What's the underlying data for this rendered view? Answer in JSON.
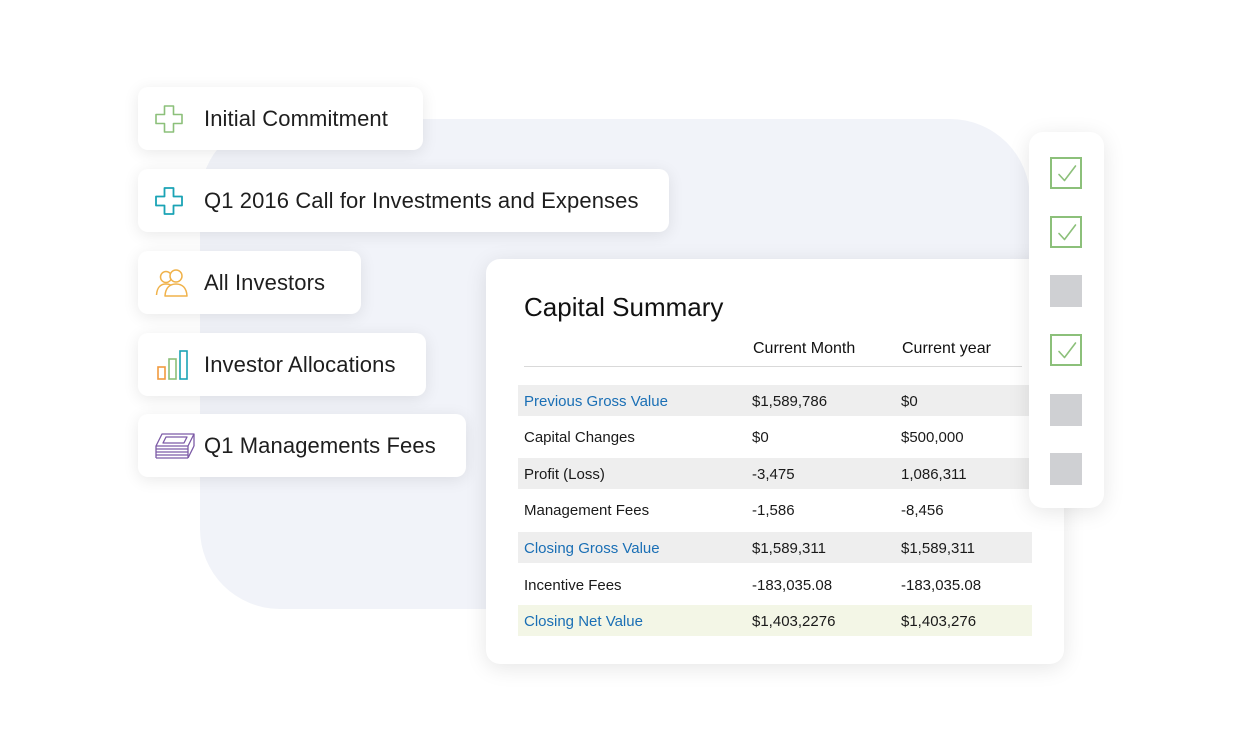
{
  "steps": [
    {
      "label": "Initial Commitment",
      "icon": "plus-outline-icon",
      "color": "#8cc07a"
    },
    {
      "label": "Q1 2016 Call for Investments and Expenses",
      "icon": "plus-outline-icon",
      "color": "#1aa3b5"
    },
    {
      "label": "All Investors",
      "icon": "investors-group-icon",
      "color": "#f0b24a"
    },
    {
      "label": "Investor Allocations",
      "icon": "bar-chart-icon",
      "colors": [
        "#f29a3e",
        "#8cc07a",
        "#1aa3b5"
      ]
    },
    {
      "label": "Q1 Managements Fees",
      "icon": "cash-stack-icon",
      "color": "#7c5aa6"
    }
  ],
  "summary": {
    "title": "Capital Summary",
    "columns": {
      "current_month": "Current Month",
      "current_year": "Current year"
    },
    "rows": [
      {
        "label": "Previous Gross Value",
        "current_month": "$1,589,786",
        "current_year": "$0",
        "style": "link",
        "shade": true
      },
      {
        "label": "Capital Changes",
        "current_month": "$0",
        "current_year": "$500,000",
        "style": "plain",
        "shade": false
      },
      {
        "label": "Profit (Loss)",
        "current_month": "-3,475",
        "current_year": "1,086,311",
        "style": "plain",
        "shade": true
      },
      {
        "label": "Management Fees",
        "current_month": "-1,586",
        "current_year": "-8,456",
        "style": "plain",
        "shade": false
      },
      {
        "label": "Closing Gross Value",
        "current_month": "$1,589,311",
        "current_year": "$1,589,311",
        "style": "link",
        "shade": true
      },
      {
        "label": "Incentive Fees",
        "current_month": "-183,035.08",
        "current_year": "-183,035.08",
        "style": "plain",
        "shade": false
      },
      {
        "label": "Closing Net Value",
        "current_month": "$1,403,2276",
        "current_year": "$1,403,276",
        "style": "link",
        "highlight": true
      }
    ]
  },
  "checklist": [
    true,
    true,
    false,
    true,
    false,
    false
  ],
  "colors": {
    "link": "#1a6fb5",
    "check": "#8cc07a",
    "unchecked": "#cfd0d3",
    "highlight_row": "#f3f6e6"
  }
}
